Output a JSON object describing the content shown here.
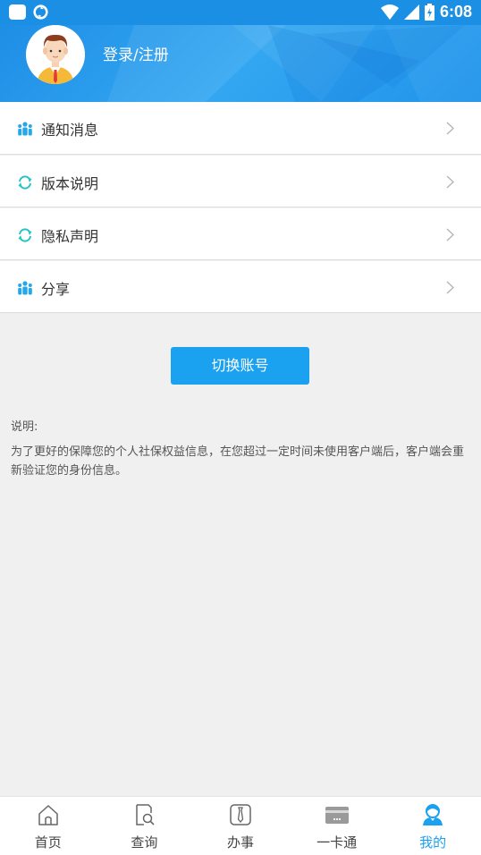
{
  "status_bar": {
    "time": "6:08"
  },
  "header": {
    "login_label": "登录/注册"
  },
  "menu": {
    "items": [
      {
        "label": "通知消息",
        "icon": "people-icon"
      },
      {
        "label": "版本说明",
        "icon": "refresh-icon"
      },
      {
        "label": "隐私声明",
        "icon": "refresh-icon"
      },
      {
        "label": "分享",
        "icon": "people-icon"
      }
    ]
  },
  "switch_button": {
    "label": "切换账号"
  },
  "note": {
    "title": "说明:",
    "body": "为了更好的保障您的个人社保权益信息，在您超过一定时间未使用客户端后，客户端会重新验证您的身份信息。"
  },
  "bottom_nav": {
    "items": [
      {
        "label": "首页",
        "icon": "home-icon"
      },
      {
        "label": "查询",
        "icon": "search-doc-icon"
      },
      {
        "label": "办事",
        "icon": "tie-icon"
      },
      {
        "label": "一卡通",
        "icon": "card-icon"
      },
      {
        "label": "我的",
        "icon": "profile-icon"
      }
    ],
    "active_index": 4
  },
  "colors": {
    "primary": "#1aa1f0",
    "header": "#1e8ee6",
    "icon_teal": "#26c4c4"
  }
}
